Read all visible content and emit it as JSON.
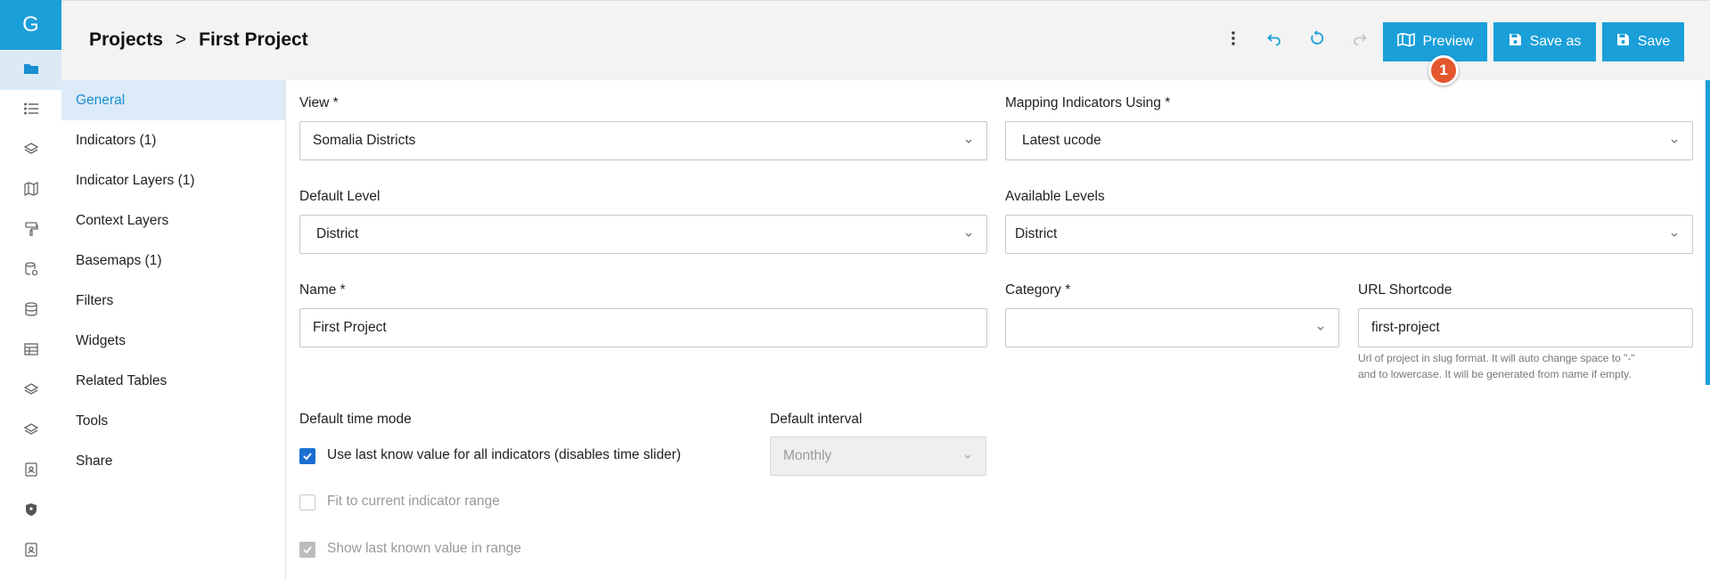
{
  "rail": {
    "logo_letter": "G",
    "items": [
      {
        "icon": "folder-icon"
      },
      {
        "icon": "list-icon"
      },
      {
        "icon": "layers-icon"
      },
      {
        "icon": "map-icon"
      },
      {
        "icon": "paint-roller-icon"
      },
      {
        "icon": "database-settings-icon"
      },
      {
        "icon": "database-icon"
      },
      {
        "icon": "table-icon"
      },
      {
        "icon": "layers-icon"
      },
      {
        "icon": "layers-icon"
      },
      {
        "icon": "user-badge-icon"
      },
      {
        "icon": "shield-icon"
      },
      {
        "icon": "user-badge-icon"
      }
    ]
  },
  "header": {
    "breadcrumb_root": "Projects",
    "breadcrumb_sep": ">",
    "breadcrumb_current": "First Project",
    "preview_label": "Preview",
    "save_as_label": "Save as",
    "save_label": "Save",
    "tour_badge": "1"
  },
  "sidenav": {
    "items": [
      {
        "label": "General",
        "active": true
      },
      {
        "label": "Indicators (1)"
      },
      {
        "label": "Indicator Layers (1)"
      },
      {
        "label": "Context Layers"
      },
      {
        "label": "Basemaps (1)"
      },
      {
        "label": "Filters"
      },
      {
        "label": "Widgets"
      },
      {
        "label": "Related Tables"
      },
      {
        "label": "Tools"
      },
      {
        "label": "Share"
      }
    ]
  },
  "form": {
    "view_label": "View *",
    "view_value": "Somalia Districts",
    "mapping_label": "Mapping Indicators Using *",
    "mapping_value": "Latest ucode",
    "default_level_label": "Default Level",
    "default_level_value": "District",
    "available_levels_label": "Available Levels",
    "available_levels_value": "District",
    "name_label": "Name *",
    "name_value": "First Project",
    "category_label": "Category *",
    "category_value": "",
    "shortcode_label": "URL Shortcode",
    "shortcode_value": "first-project",
    "shortcode_help_1": "Url of project in slug format. It will auto change space to \"-\"",
    "shortcode_help_2": "and to lowercase. It will be generated from name if empty.",
    "time_mode_label": "Default time mode",
    "interval_label": "Default interval",
    "interval_value": "Monthly",
    "opt_last_known": "Use last know value for all indicators (disables time slider)",
    "opt_fit_range": "Fit to current indicator range",
    "opt_show_last": "Show last known value in range"
  },
  "colors": {
    "accent": "#1a9fd9",
    "badge": "#e4572e",
    "checkbox": "#1a6fd1"
  }
}
